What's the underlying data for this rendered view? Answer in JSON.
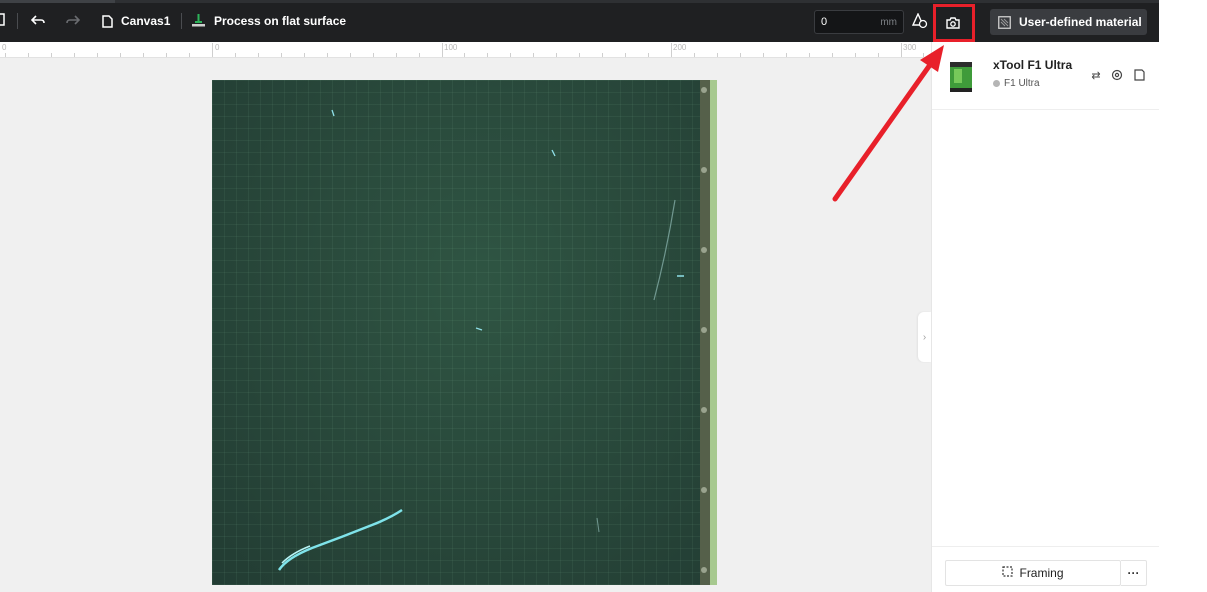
{
  "toolbar": {
    "canvas_name": "Canvas1",
    "process_mode": "Process on flat surface",
    "thickness_value": "0",
    "thickness_unit": "mm",
    "material_label": "User-defined material"
  },
  "ruler": {
    "labels": [
      "0",
      "100",
      "200",
      "300"
    ]
  },
  "device": {
    "name": "xTool F1 Ultra",
    "model": "F1 Ultra"
  },
  "footer": {
    "framing_label": "Framing",
    "more_label": "···"
  },
  "colors": {
    "toolbar_bg": "#1f2022",
    "highlight": "#e8202a",
    "canvas_bg": "#f0f0f0",
    "preview_green": "#28473a"
  },
  "icons": [
    "menu-icon",
    "undo-icon",
    "redo-icon",
    "file-icon",
    "flat-surface-icon",
    "auto-measure-icon",
    "camera-icon",
    "material-icon",
    "swap-icon",
    "settings-icon",
    "save-icon",
    "framing-icon",
    "chevron-right-icon"
  ]
}
